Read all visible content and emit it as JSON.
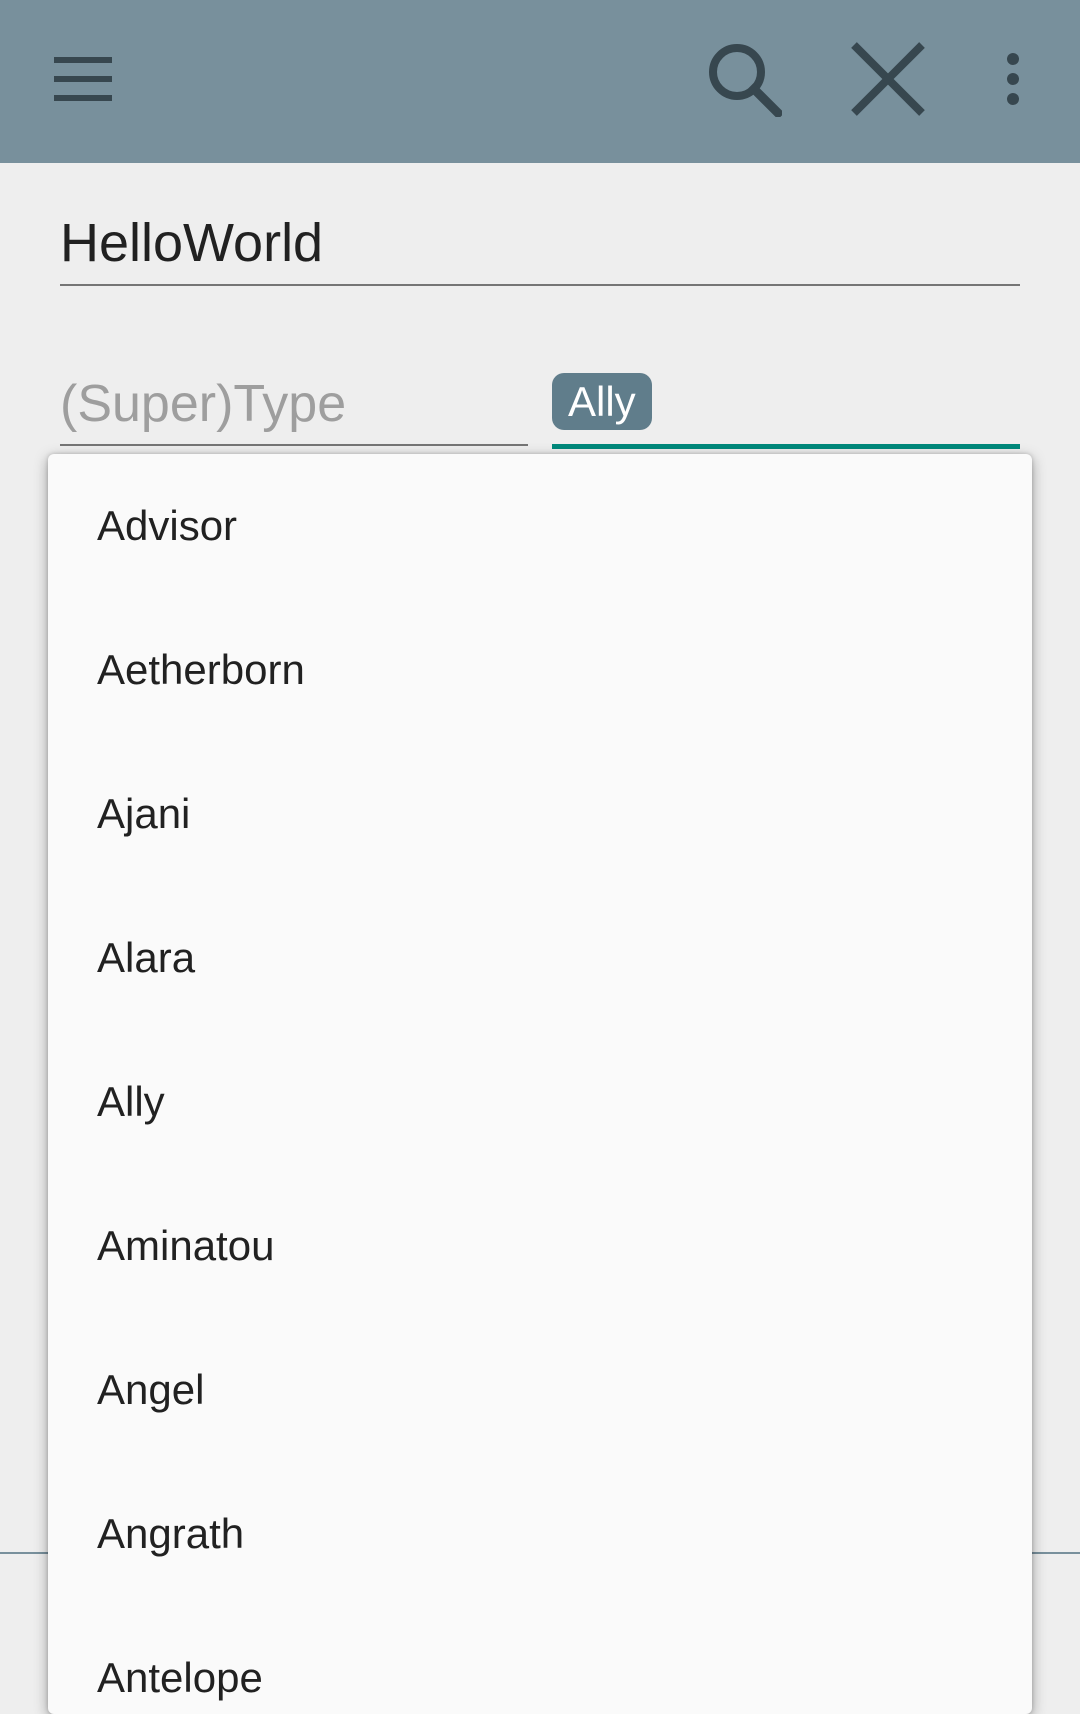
{
  "toolbar": {
    "menu_icon": "hamburger-menu-icon",
    "search_icon": "search-icon",
    "close_icon": "close-icon",
    "more_icon": "more-vert-icon",
    "background_color": "#78909c"
  },
  "form": {
    "name_value": "HelloWorld",
    "type_placeholder": "(Super)Type",
    "subtype_chip": "Ally",
    "accent_color": "#00897b"
  },
  "dropdown": {
    "items": [
      "Advisor",
      "Aetherborn",
      "Ajani",
      "Alara",
      "Ally",
      "Aminatou",
      "Angel",
      "Angrath",
      "Antelope"
    ]
  }
}
